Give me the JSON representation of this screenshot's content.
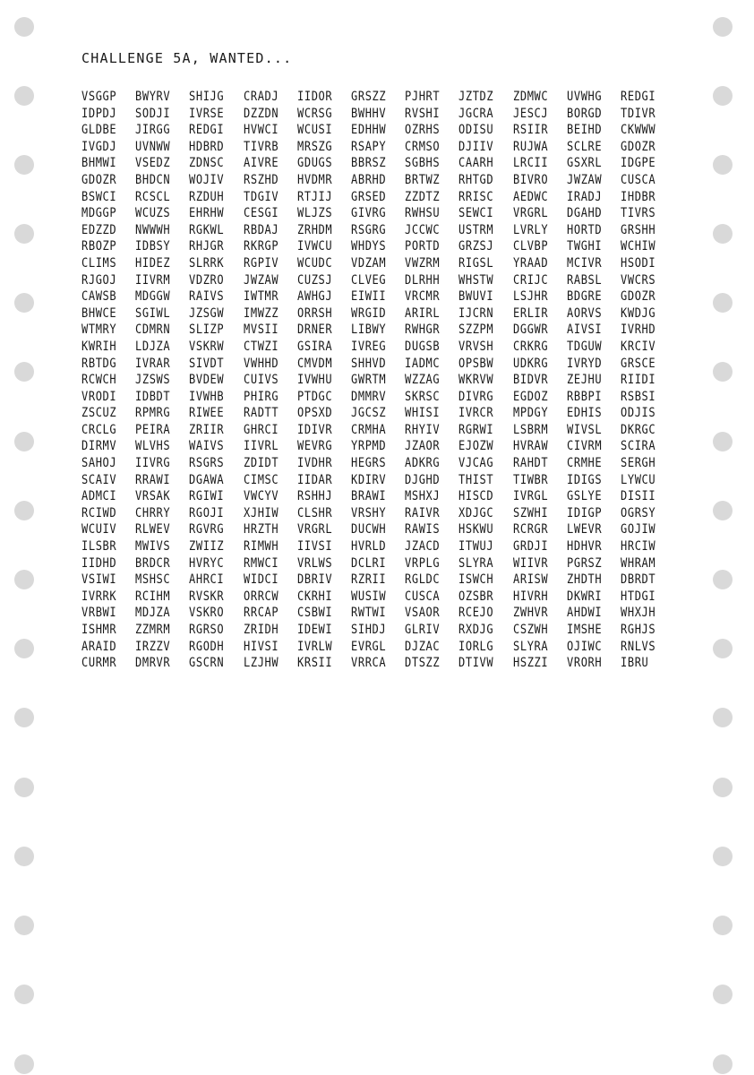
{
  "title": "CHALLENGE 5A, WANTED...",
  "cipher_lines": [
    [
      "VSGGP",
      "BWYRV",
      "SHIJG",
      "CRADJ",
      "IIDOR",
      "GRSZZ",
      "PJHRT",
      "JZTDZ",
      "ZDMWC",
      "UVWHG",
      "REDGI"
    ],
    [
      "IDPDJ",
      "SODJI",
      "IVRSE",
      "DZZDN",
      "WCRSG",
      "BWHHV",
      "RVSHI",
      "JGCRA",
      "JESCJ",
      "BORGD",
      "TDIVR"
    ],
    [
      "GLDBE",
      "JIRGG",
      "REDGI",
      "HVWCI",
      "WCUSI",
      "EDHHW",
      "OZRHS",
      "ODISU",
      "RSIIR",
      "BEIHD",
      "CKWWW"
    ],
    [
      "IVGDJ",
      "UVNWW",
      "HDBRD",
      "TIVRB",
      "MRSZG",
      "RSAPY",
      "CRMSO",
      "DJIIV",
      "RUJWA",
      "SCLRE",
      "GDOZR"
    ],
    [
      "BHMWI",
      "VSEDZ",
      "ZDNSC",
      "AIVRE",
      "GDUGS",
      "BBRSZ",
      "SGBHS",
      "CAARH",
      "LRCII",
      "GSXRL",
      "IDGPE"
    ],
    [
      "GDOZR",
      "BHDCN",
      "WOJIV",
      "RSZHD",
      "HVDMR",
      "ABRHD",
      "BRTWZ",
      "RHTGD",
      "BIVRO",
      "JWZAW",
      "CUSCA"
    ],
    [
      "BSWCI",
      "RCSCL",
      "RZDUH",
      "TDGIV",
      "RTJIJ",
      "GRSED",
      "ZZDTZ",
      "RRISC",
      "AEDWC",
      "IRADJ",
      "IHDBR"
    ],
    [
      "MDGGP",
      "WCUZS",
      "EHRHW",
      "CESGI",
      "WLJZS",
      "GIVRG",
      "RWHSU",
      "SEWCI",
      "VRGRL",
      "DGAHD",
      "TIVRS"
    ],
    [
      "EDZZD",
      "NWWWH",
      "RGKWL",
      "RBDAJ",
      "ZRHDM",
      "RSGRG",
      "JCCWC",
      "USTRM",
      "LVRLY",
      "HORTD",
      "GRSHH"
    ],
    [
      "RBOZP",
      "IDBSY",
      "RHJGR",
      "RKRGP",
      "IVWCU",
      "WHDYS",
      "PORTD",
      "GRZSJ",
      "CLVBP",
      "TWGHI",
      "WCHIW"
    ],
    [
      "CLIMS",
      "HIDEZ",
      "SLRRK",
      "RGPIV",
      "WCUDC",
      "VDZAM",
      "VWZRM",
      "RIGSL",
      "YRAAD",
      "MCIVR",
      "HSODI"
    ],
    [
      "RJGOJ",
      "IIVRM",
      "VDZRO",
      "JWZAW",
      "CUZSJ",
      "CLVEG",
      "DLRHH",
      "WHSTW",
      "CRIJC",
      "RABSL",
      "VWCRS"
    ],
    [
      "CAWSB",
      "MDGGW",
      "RAIVS",
      "IWTMR",
      "AWHGJ",
      "EIWII",
      "VRCMR",
      "BWUVI",
      "LSJHR",
      "BDGRE",
      "GDOZR"
    ],
    [
      "BHWCE",
      "SGIWL",
      "JZSGW",
      "IMWZZ",
      "ORRSH",
      "WRGID",
      "ARIRL",
      "IJCRN",
      "ERLIR",
      "AORVS",
      "KWDJG"
    ],
    [
      "WTMRY",
      "CDMRN",
      "SLIZP",
      "MVSII",
      "DRNER",
      "LIBWY",
      "RWHGR",
      "SZZPM",
      "DGGWR",
      "AIVSI",
      "IVRHD"
    ],
    [
      "KWRIH",
      "LDJZA",
      "VSKRW",
      "CTWZI",
      "GSIRA",
      "IVREG",
      "DUGSB",
      "VRVSH",
      "CRKRG",
      "TDGUW",
      "KRCIV"
    ],
    [
      "RBTDG",
      "IVRAR",
      "SIVDT",
      "VWHHD",
      "CMVDM",
      "SHHVD",
      "IADMC",
      "OPSBW",
      "UDKRG",
      "IVRYD",
      "GRSCE"
    ],
    [
      "RCWCH",
      "JZSWS",
      "BVDEW",
      "CUIVS",
      "IVWHU",
      "GWRTM",
      "WZZAG",
      "WKRVW",
      "BIDVR",
      "ZEJHU",
      "RIIDI"
    ],
    [
      "VRODI",
      "IDBDT",
      "IVWHB",
      "PHIRG",
      "PTDGC",
      "DMMRV",
      "SKRSC",
      "DIVRG",
      "EGDOZ",
      "RBBPI",
      "RSBSI"
    ],
    [
      "ZSCUZ",
      "RPMRG",
      "RIWEE",
      "RADTT",
      "OPSXD",
      "JGCSZ",
      "WHISI",
      "IVRCR",
      "MPDGY",
      "EDHIS",
      "ODJIS"
    ],
    [
      "CRCLG",
      "PEIRA",
      "ZRIIR",
      "GHRCI",
      "IDIVR",
      "CRMHA",
      "RHYIV",
      "RGRWI",
      "LSBRM",
      "WIVSL",
      "DKRGC"
    ],
    [
      "DIRMV",
      "WLVHS",
      "WAIVS",
      "IIVRL",
      "WEVRG",
      "YRPMD",
      "JZAOR",
      "EJOZW",
      "HVRAW",
      "CIVRM",
      "SCIRA"
    ],
    [
      "SAHOJ",
      "IIVRG",
      "RSGRS",
      "ZDIDT",
      "IVDHR",
      "HEGRS",
      "ADKRG",
      "VJCAG",
      "RAHDT",
      "CRMHE",
      "SERGH"
    ],
    [
      "SCAIV",
      "RRAWI",
      "DGAWA",
      "CIMSC",
      "IIDAR",
      "KDIRV",
      "DJGHD",
      "THIST",
      "TIWBR",
      "IDIGS",
      "LYWCU"
    ],
    [
      "ADMCI",
      "VRSAK",
      "RGIWI",
      "VWCYV",
      "RSHHJ",
      "BRAWI",
      "MSHXJ",
      "HISCD",
      "IVRGL",
      "GSLYE",
      "DISII"
    ],
    [
      "RCIWD",
      "CHRRY",
      "RGOJI",
      "XJHIW",
      "CLSHR",
      "VRSHY",
      "RAIVR",
      "XDJGC",
      "SZWHI",
      "IDIGP",
      "OGRSY"
    ],
    [
      "WCUIV",
      "RLWEV",
      "RGVRG",
      "HRZTH",
      "VRGRL",
      "DUCWH",
      "RAWIS",
      "HSKWU",
      "RCRGR",
      "LWEVR",
      "GOJIW"
    ],
    [
      "ILSBR",
      "MWIVS",
      "ZWIIZ",
      "RIMWH",
      "IIVSI",
      "HVRLD",
      "JZACD",
      "ITWUJ",
      "GRDJI",
      "HDHVR",
      "HRCIW"
    ],
    [
      "IIDHD",
      "BRDCR",
      "HVRYC",
      "RMWCI",
      "VRLWS",
      "DCLRI",
      "VRPLG",
      "SLYRA",
      "WIIVR",
      "PGRSZ",
      "WHRAM"
    ],
    [
      "VSIWI",
      "MSHSC",
      "AHRCI",
      "WIDCI",
      "DBRIV",
      "RZRII",
      "RGLDC",
      "ISWCH",
      "ARISW",
      "ZHDTH",
      "DBRDT"
    ],
    [
      "IVRRK",
      "RCIHM",
      "RVSKR",
      "ORRCW",
      "CKRHI",
      "WUSIW",
      "CUSCA",
      "OZSBR",
      "HIVRH",
      "DKWRI",
      "HTDGI"
    ],
    [
      "VRBWI",
      "MDJZA",
      "VSKRO",
      "RRCAP",
      "CSBWI",
      "RWTWI",
      "VSAOR",
      "RCEJO",
      "ZWHVR",
      "AHDWI",
      "WHXJH"
    ],
    [
      "ISHMR",
      "ZZMRM",
      "RGRSO",
      "ZRIDH",
      "IDEWI",
      "SIHDJ",
      "GLRIV",
      "RXDJG",
      "CSZWH",
      "IMSHE",
      "RGHJS"
    ],
    [
      "ARAID",
      "IRZZV",
      "RGODH",
      "HIVSI",
      "IVRLW",
      "EVRGL",
      "DJZAC",
      "IORLG",
      "SLYRA",
      "OJIWC",
      "RNLVS"
    ],
    [
      "CURMR",
      "DMRVR",
      "GSCRN",
      "LZJHW",
      "KRSII",
      "VRRCA",
      "DTSZZ",
      "DTIVW",
      "HSZZI",
      "VRORH",
      "IBRU"
    ]
  ]
}
